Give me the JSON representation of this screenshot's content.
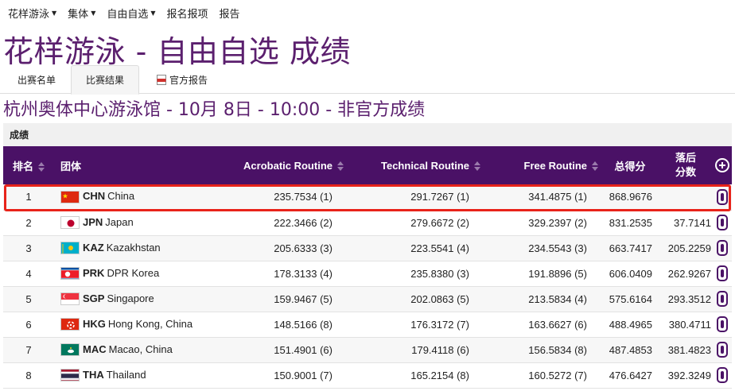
{
  "topnav": [
    {
      "label": "花样游泳",
      "dropdown": true
    },
    {
      "label": "集体",
      "dropdown": true
    },
    {
      "label": "自由自选",
      "dropdown": true
    },
    {
      "label": "报名报项",
      "dropdown": false
    },
    {
      "label": "报告",
      "dropdown": false
    }
  ],
  "page_title": "花样游泳 - 自由自选 成绩",
  "tabs": {
    "entry_list": "出赛名单",
    "results": "比赛结果",
    "official_report": "官方报告"
  },
  "subtitle": "杭州奥体中心游泳馆 - 10月 8日 - 10:00 - 非官方成绩",
  "section_heading": "成绩",
  "table": {
    "headers": {
      "rank": "排名",
      "team": "团体",
      "acrobatic": "Acrobatic Routine",
      "technical": "Technical Routine",
      "free": "Free Routine",
      "total": "总得分",
      "behind_line1": "落后",
      "behind_line2": "分数"
    },
    "rows": [
      {
        "rank": "1",
        "code": "CHN",
        "name": "China",
        "flag": "chn",
        "acrobatic": "235.7534 (1)",
        "technical": "291.7267 (1)",
        "free": "341.4875 (1)",
        "total": "868.9676",
        "behind": ""
      },
      {
        "rank": "2",
        "code": "JPN",
        "name": "Japan",
        "flag": "jpn",
        "acrobatic": "222.3466 (2)",
        "technical": "279.6672 (2)",
        "free": "329.2397 (2)",
        "total": "831.2535",
        "behind": "37.7141"
      },
      {
        "rank": "3",
        "code": "KAZ",
        "name": "Kazakhstan",
        "flag": "kaz",
        "acrobatic": "205.6333 (3)",
        "technical": "223.5541 (4)",
        "free": "234.5543 (3)",
        "total": "663.7417",
        "behind": "205.2259"
      },
      {
        "rank": "4",
        "code": "PRK",
        "name": "DPR Korea",
        "flag": "prk",
        "acrobatic": "178.3133 (4)",
        "technical": "235.8380 (3)",
        "free": "191.8896 (5)",
        "total": "606.0409",
        "behind": "262.9267"
      },
      {
        "rank": "5",
        "code": "SGP",
        "name": "Singapore",
        "flag": "sgp",
        "acrobatic": "159.9467 (5)",
        "technical": "202.0863 (5)",
        "free": "213.5834 (4)",
        "total": "575.6164",
        "behind": "293.3512"
      },
      {
        "rank": "6",
        "code": "HKG",
        "name": "Hong Kong, China",
        "flag": "hkg",
        "acrobatic": "148.5166 (8)",
        "technical": "176.3172 (7)",
        "free": "163.6627 (6)",
        "total": "488.4965",
        "behind": "380.4711"
      },
      {
        "rank": "7",
        "code": "MAC",
        "name": "Macao, China",
        "flag": "mac",
        "acrobatic": "151.4901 (6)",
        "technical": "179.4118 (6)",
        "free": "156.5834 (8)",
        "total": "487.4853",
        "behind": "381.4823"
      },
      {
        "rank": "8",
        "code": "THA",
        "name": "Thailand",
        "flag": "tha",
        "acrobatic": "150.9001 (7)",
        "technical": "165.2154 (8)",
        "free": "160.5272 (7)",
        "total": "476.6427",
        "behind": "392.3249"
      }
    ]
  },
  "colors": {
    "title": "#5b1f6e",
    "table_header": "#4a1166",
    "highlight_border": "#e8231a"
  }
}
